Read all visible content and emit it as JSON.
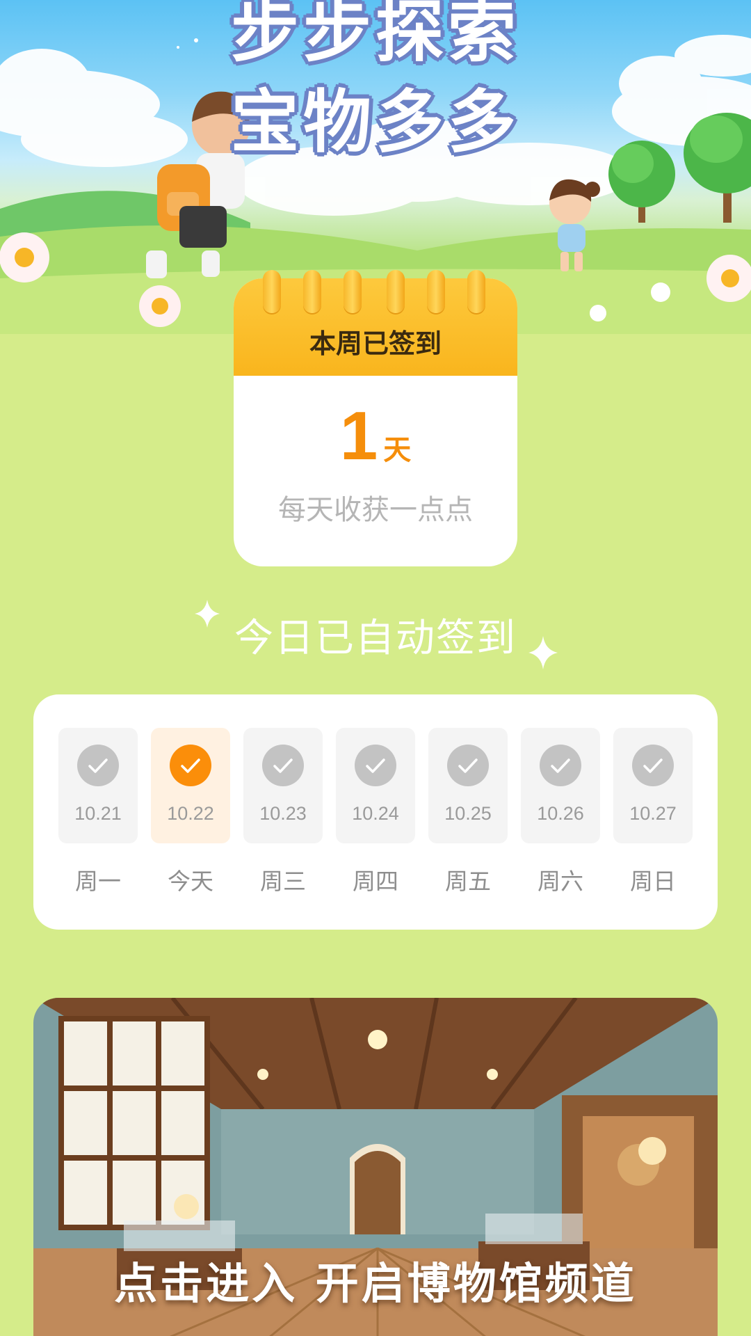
{
  "hero": {
    "title_line1": "步步探索",
    "title_line2": "宝物多多"
  },
  "calendar": {
    "header": "本周已签到",
    "count": "1",
    "unit": "天",
    "subtitle": "每天收获一点点"
  },
  "auto_sign_text": "今日已自动签到",
  "week": [
    {
      "date": "10.21",
      "label": "周一",
      "checked": true,
      "today": false
    },
    {
      "date": "10.22",
      "label": "今天",
      "checked": true,
      "today": true
    },
    {
      "date": "10.23",
      "label": "周三",
      "checked": true,
      "today": false
    },
    {
      "date": "10.24",
      "label": "周四",
      "checked": true,
      "today": false
    },
    {
      "date": "10.25",
      "label": "周五",
      "checked": true,
      "today": false
    },
    {
      "date": "10.26",
      "label": "周六",
      "checked": true,
      "today": false
    },
    {
      "date": "10.27",
      "label": "周日",
      "checked": true,
      "today": false
    }
  ],
  "banner": {
    "text": "点击进入 开启博物馆频道"
  },
  "colors": {
    "background": "#d5ec8a",
    "accent_orange": "#fb8e0a",
    "calendar_header": "#fdc93d",
    "title_outline": "#6c82c6"
  },
  "icons": {
    "check": "check-circle-icon",
    "sparkle": "sparkle-icon"
  }
}
